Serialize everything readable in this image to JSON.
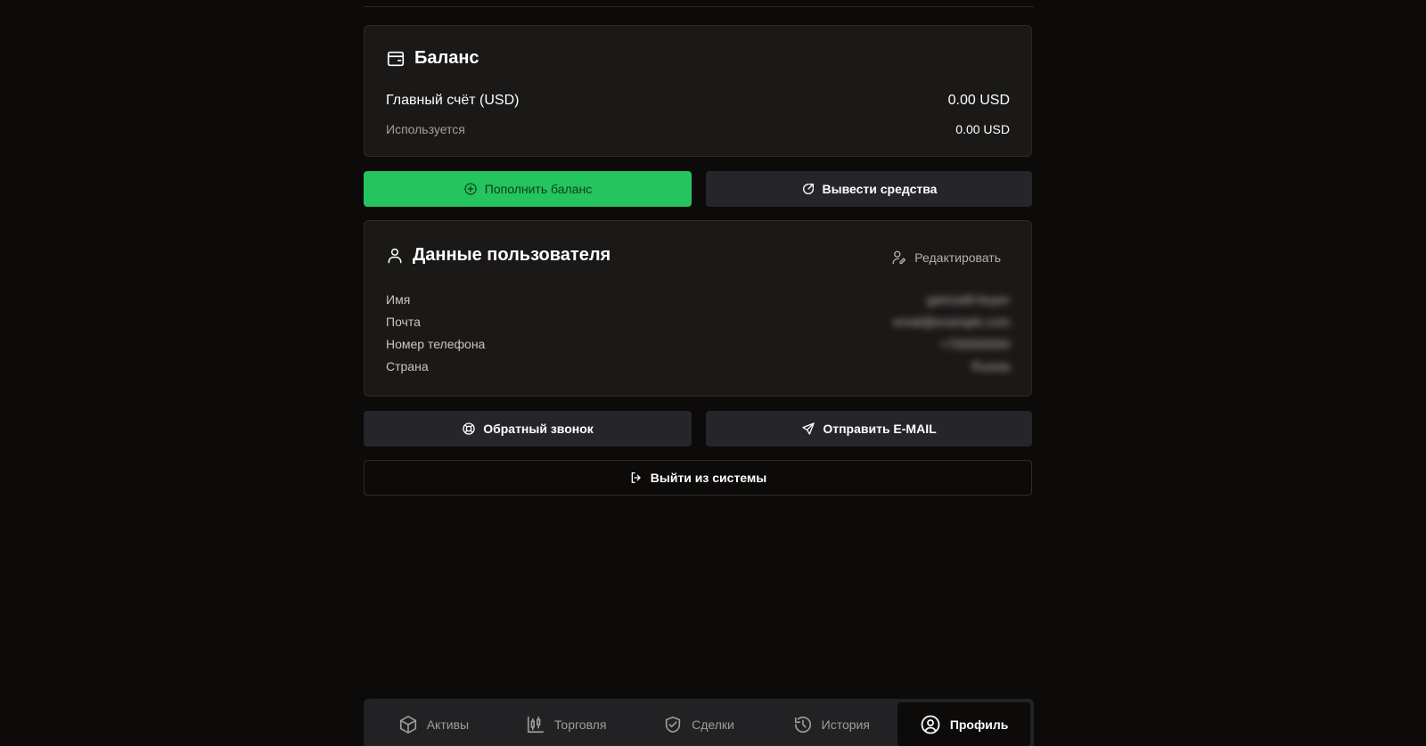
{
  "balance": {
    "title": "Баланс",
    "main_account_label": "Главный счёт (USD)",
    "main_account_value": "0.00 USD",
    "used_label": "Используется",
    "used_value": "0.00 USD"
  },
  "actions": {
    "deposit_label": "Пополнить баланс",
    "withdraw_label": "Вывести средства"
  },
  "user": {
    "title": "Данные пользователя",
    "edit_label": "Редактировать",
    "fields": [
      {
        "label": "Имя",
        "value": "gamzat9-buyer"
      },
      {
        "label": "Почта",
        "value": "email@example.com"
      },
      {
        "label": "Номер телефона",
        "value": "+700000000"
      },
      {
        "label": "Страна",
        "value": "Russia"
      }
    ]
  },
  "contact": {
    "callback_label": "Обратный звонок",
    "email_label": "Отправить E-MAIL",
    "logout_label": "Выйти из системы"
  },
  "nav": {
    "items": [
      {
        "label": "Активы",
        "icon": "cube-icon"
      },
      {
        "label": "Торговля",
        "icon": "candles-icon"
      },
      {
        "label": "Сделки",
        "icon": "handshake-icon"
      },
      {
        "label": "История",
        "icon": "history-icon"
      },
      {
        "label": "Профиль",
        "icon": "user-circle-icon"
      }
    ],
    "active_index": 4
  },
  "colors": {
    "background": "#0c0b0a",
    "card": "#1b1918",
    "accent_green": "#24c55e",
    "button_dark": "#26252a"
  }
}
